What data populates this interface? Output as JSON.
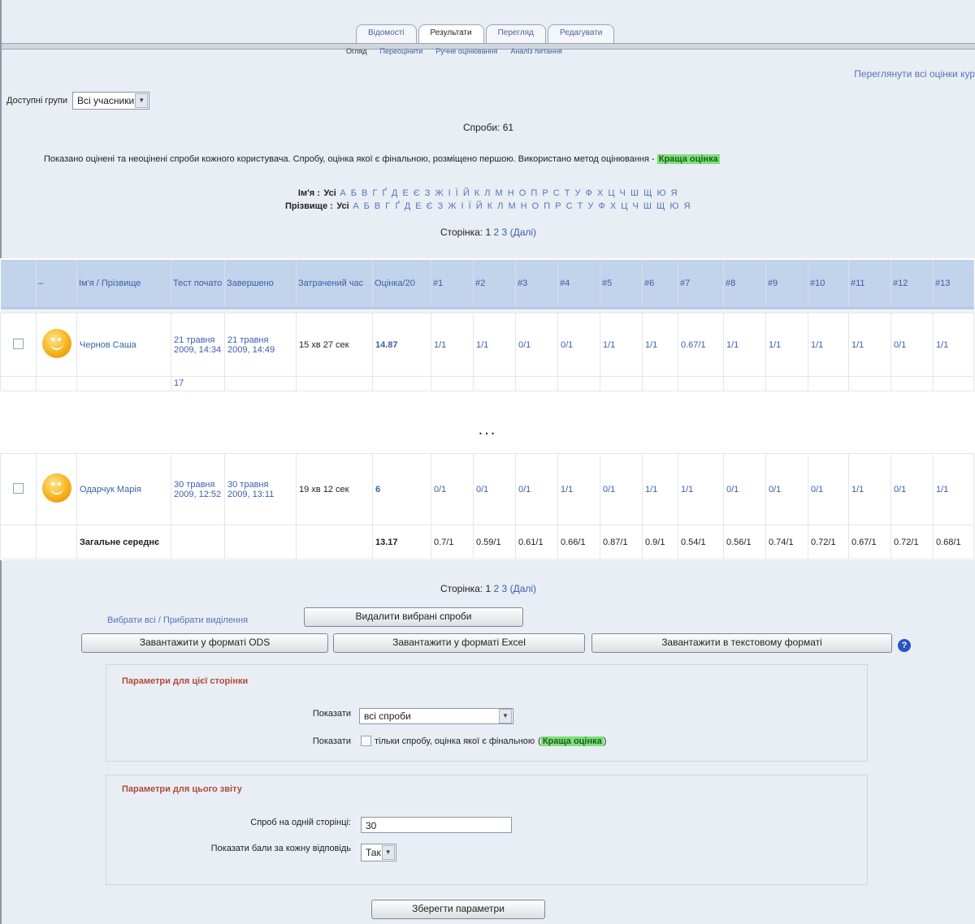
{
  "tabs": [
    {
      "label": "Відомості",
      "active": false
    },
    {
      "label": "Результати",
      "active": true
    },
    {
      "label": "Перегляд",
      "active": false
    },
    {
      "label": "Редагувати",
      "active": false
    }
  ],
  "subtabs": [
    "Огляд",
    "Переоцінити",
    "Ручне оцінювання",
    "Аналіз питання"
  ],
  "regrade_link": "Переглянути всі оцінки кур",
  "groups": {
    "label": "Доступні групи",
    "value": "Всі учасники"
  },
  "attempts_label": "Спроби: 61",
  "shown_text": "Показано оцінені та неоцінені спроби кожного користувача. Спробу, оцінка якої є фінальною, розміщено першою. Використано метод оцінювання - ",
  "grading_method": "Краща оцінка",
  "alpha": {
    "first_label": "Ім'я :",
    "last_label": "Прізвище :",
    "all": "Усі",
    "letters": "А Б В Г Ґ Д Е Є З Ж І Ї Й К Л М Н О П Р С Т У Ф Х Ц Ч Ш Щ Ю Я"
  },
  "pager": {
    "label": "Сторінка:",
    "pages": [
      "1",
      "2",
      "3"
    ],
    "next": "(Далі)"
  },
  "table": {
    "headers": [
      "",
      "",
      "Ім'я / Прізвище",
      "Тест почато",
      "Завершено",
      "Затрачений час",
      "Оцінка/20",
      "#1",
      "#2",
      "#3",
      "#4",
      "#5",
      "#6",
      "#7",
      "#8",
      "#9",
      "#10",
      "#11",
      "#12",
      "#13"
    ],
    "rows_top": [
      {
        "name": "Чернов Саша",
        "started": "21 травня 2009, 14:34",
        "finished": "21 травня 2009, 14:49",
        "time": "15 хв 27 сек",
        "grade": "14.87",
        "q": [
          "1/1",
          "1/1",
          "0/1",
          "0/1",
          "1/1",
          "1/1",
          "0.67/1",
          "1/1",
          "1/1",
          "1/1",
          "1/1",
          "0/1",
          "1/1"
        ]
      }
    ],
    "partial_next": "17",
    "ellipsis": "...",
    "rows_bottom": [
      {
        "name": "Одарчук Марія",
        "started": "30 травня 2009, 12:52",
        "finished": "30 травня 2009, 13:11",
        "time": "19 хв 12 сек",
        "grade": "6",
        "q": [
          "0/1",
          "0/1",
          "0/1",
          "1/1",
          "0/1",
          "1/1",
          "1/1",
          "0/1",
          "0/1",
          "0/1",
          "1/1",
          "0/1",
          "1/1"
        ]
      }
    ],
    "average": {
      "label": "Загальне середнє",
      "grade": "13.17",
      "q": [
        "0.7/1",
        "0.59/1",
        "0.61/1",
        "0.66/1",
        "0.87/1",
        "0.9/1",
        "0.54/1",
        "0.56/1",
        "0.74/1",
        "0.72/1",
        "0.67/1",
        "0.72/1",
        "0.68/1"
      ]
    }
  },
  "bottom": {
    "select_all": "Вибрати всі / Прибрати виділення",
    "delete_button": "Видалити вибрані спроби",
    "download_ods": "Завантажити у форматі ODS",
    "download_excel": "Завантажити у форматі Excel",
    "download_text": "Завантажити в текстовому форматі",
    "page_settings": {
      "legend": "Параметри для цієї сторінки",
      "show_label": "Показати",
      "show_value": "всі спроби",
      "show_label2": "Показати",
      "final_only": "тільки спробу, оцінка якої є фінальною",
      "final_hl": "Краща оцінка"
    },
    "report_settings": {
      "legend": "Параметри для цього звіту",
      "per_page_label": "Спроб на одній сторінці:",
      "per_page_value": "30",
      "show_marks_label": "Показати бали за кожну відповідь",
      "show_marks_value": "Так"
    },
    "save_button": "Зберегти параметри"
  }
}
